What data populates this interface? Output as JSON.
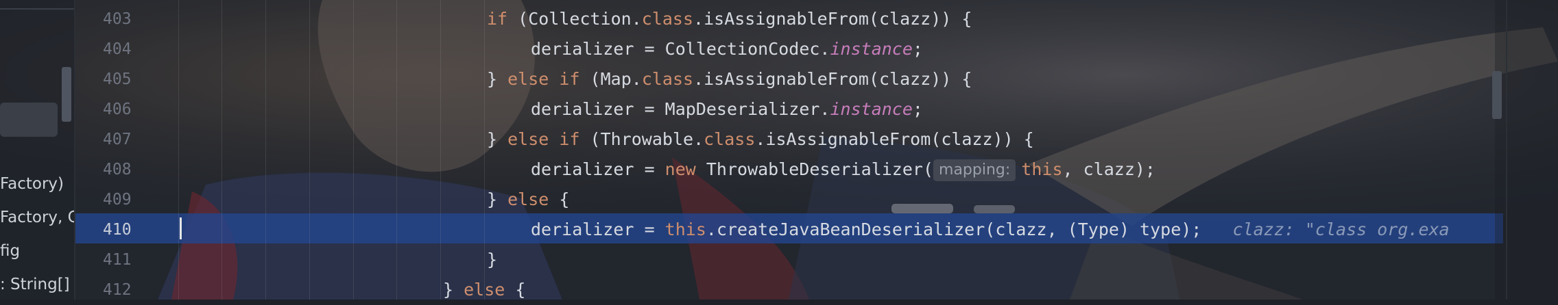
{
  "left_panel": {
    "items": [
      {
        "label": "Factory)"
      },
      {
        "label": "Factory, Cl"
      },
      {
        "label": "fig"
      },
      {
        "label": ": String[]"
      }
    ]
  },
  "editor": {
    "lines": [
      {
        "number": "403"
      },
      {
        "number": "404"
      },
      {
        "number": "405"
      },
      {
        "number": "406"
      },
      {
        "number": "407"
      },
      {
        "number": "408"
      },
      {
        "number": "409"
      },
      {
        "number": "410"
      },
      {
        "number": "411"
      },
      {
        "number": "412"
      }
    ],
    "code": {
      "l403": {
        "kw_if": "if",
        "a": " (Collection.",
        "kw_class": "class",
        "b": ".isAssignableFrom(clazz)) {"
      },
      "l404": {
        "a": "derializer = CollectionCodec.",
        "it": "instance",
        "b": ";"
      },
      "l405": {
        "a": "} ",
        "kw_else": "else",
        "sp": " ",
        "kw_if": "if",
        "b": " (Map.",
        "kw_class": "class",
        "c": ".isAssignableFrom(clazz)) {"
      },
      "l406": {
        "a": "derializer = MapDeserializer.",
        "it": "instance",
        "b": ";"
      },
      "l407": {
        "a": "} ",
        "kw_else": "else",
        "sp": " ",
        "kw_if": "if",
        "b": " (Throwable.",
        "kw_class": "class",
        "c": ".isAssignableFrom(clazz)) {"
      },
      "l408": {
        "a": "derializer = ",
        "kw_new": "new",
        "b": " ThrowableDeserializer(",
        "hint": "mapping:",
        "kw_this": "this",
        "c": ", clazz);"
      },
      "l409": {
        "a": "} ",
        "kw_else": "else",
        "b": " {"
      },
      "l410": {
        "a": "derializer = ",
        "kw_this": "this",
        "b": ".createJavaBeanDeserializer(clazz, (Type) type);",
        "inline": "clazz: \"class org.exa"
      },
      "l411": {
        "a": "}"
      },
      "l412": {
        "a": "} ",
        "kw_else": "else",
        "b": " {"
      }
    }
  },
  "colors": {
    "keyword": "#cf8e6d",
    "static_field": "#c77dbb",
    "highlight": "#2346a0",
    "text": "#d6dae1",
    "line_number": "#6e7480"
  }
}
